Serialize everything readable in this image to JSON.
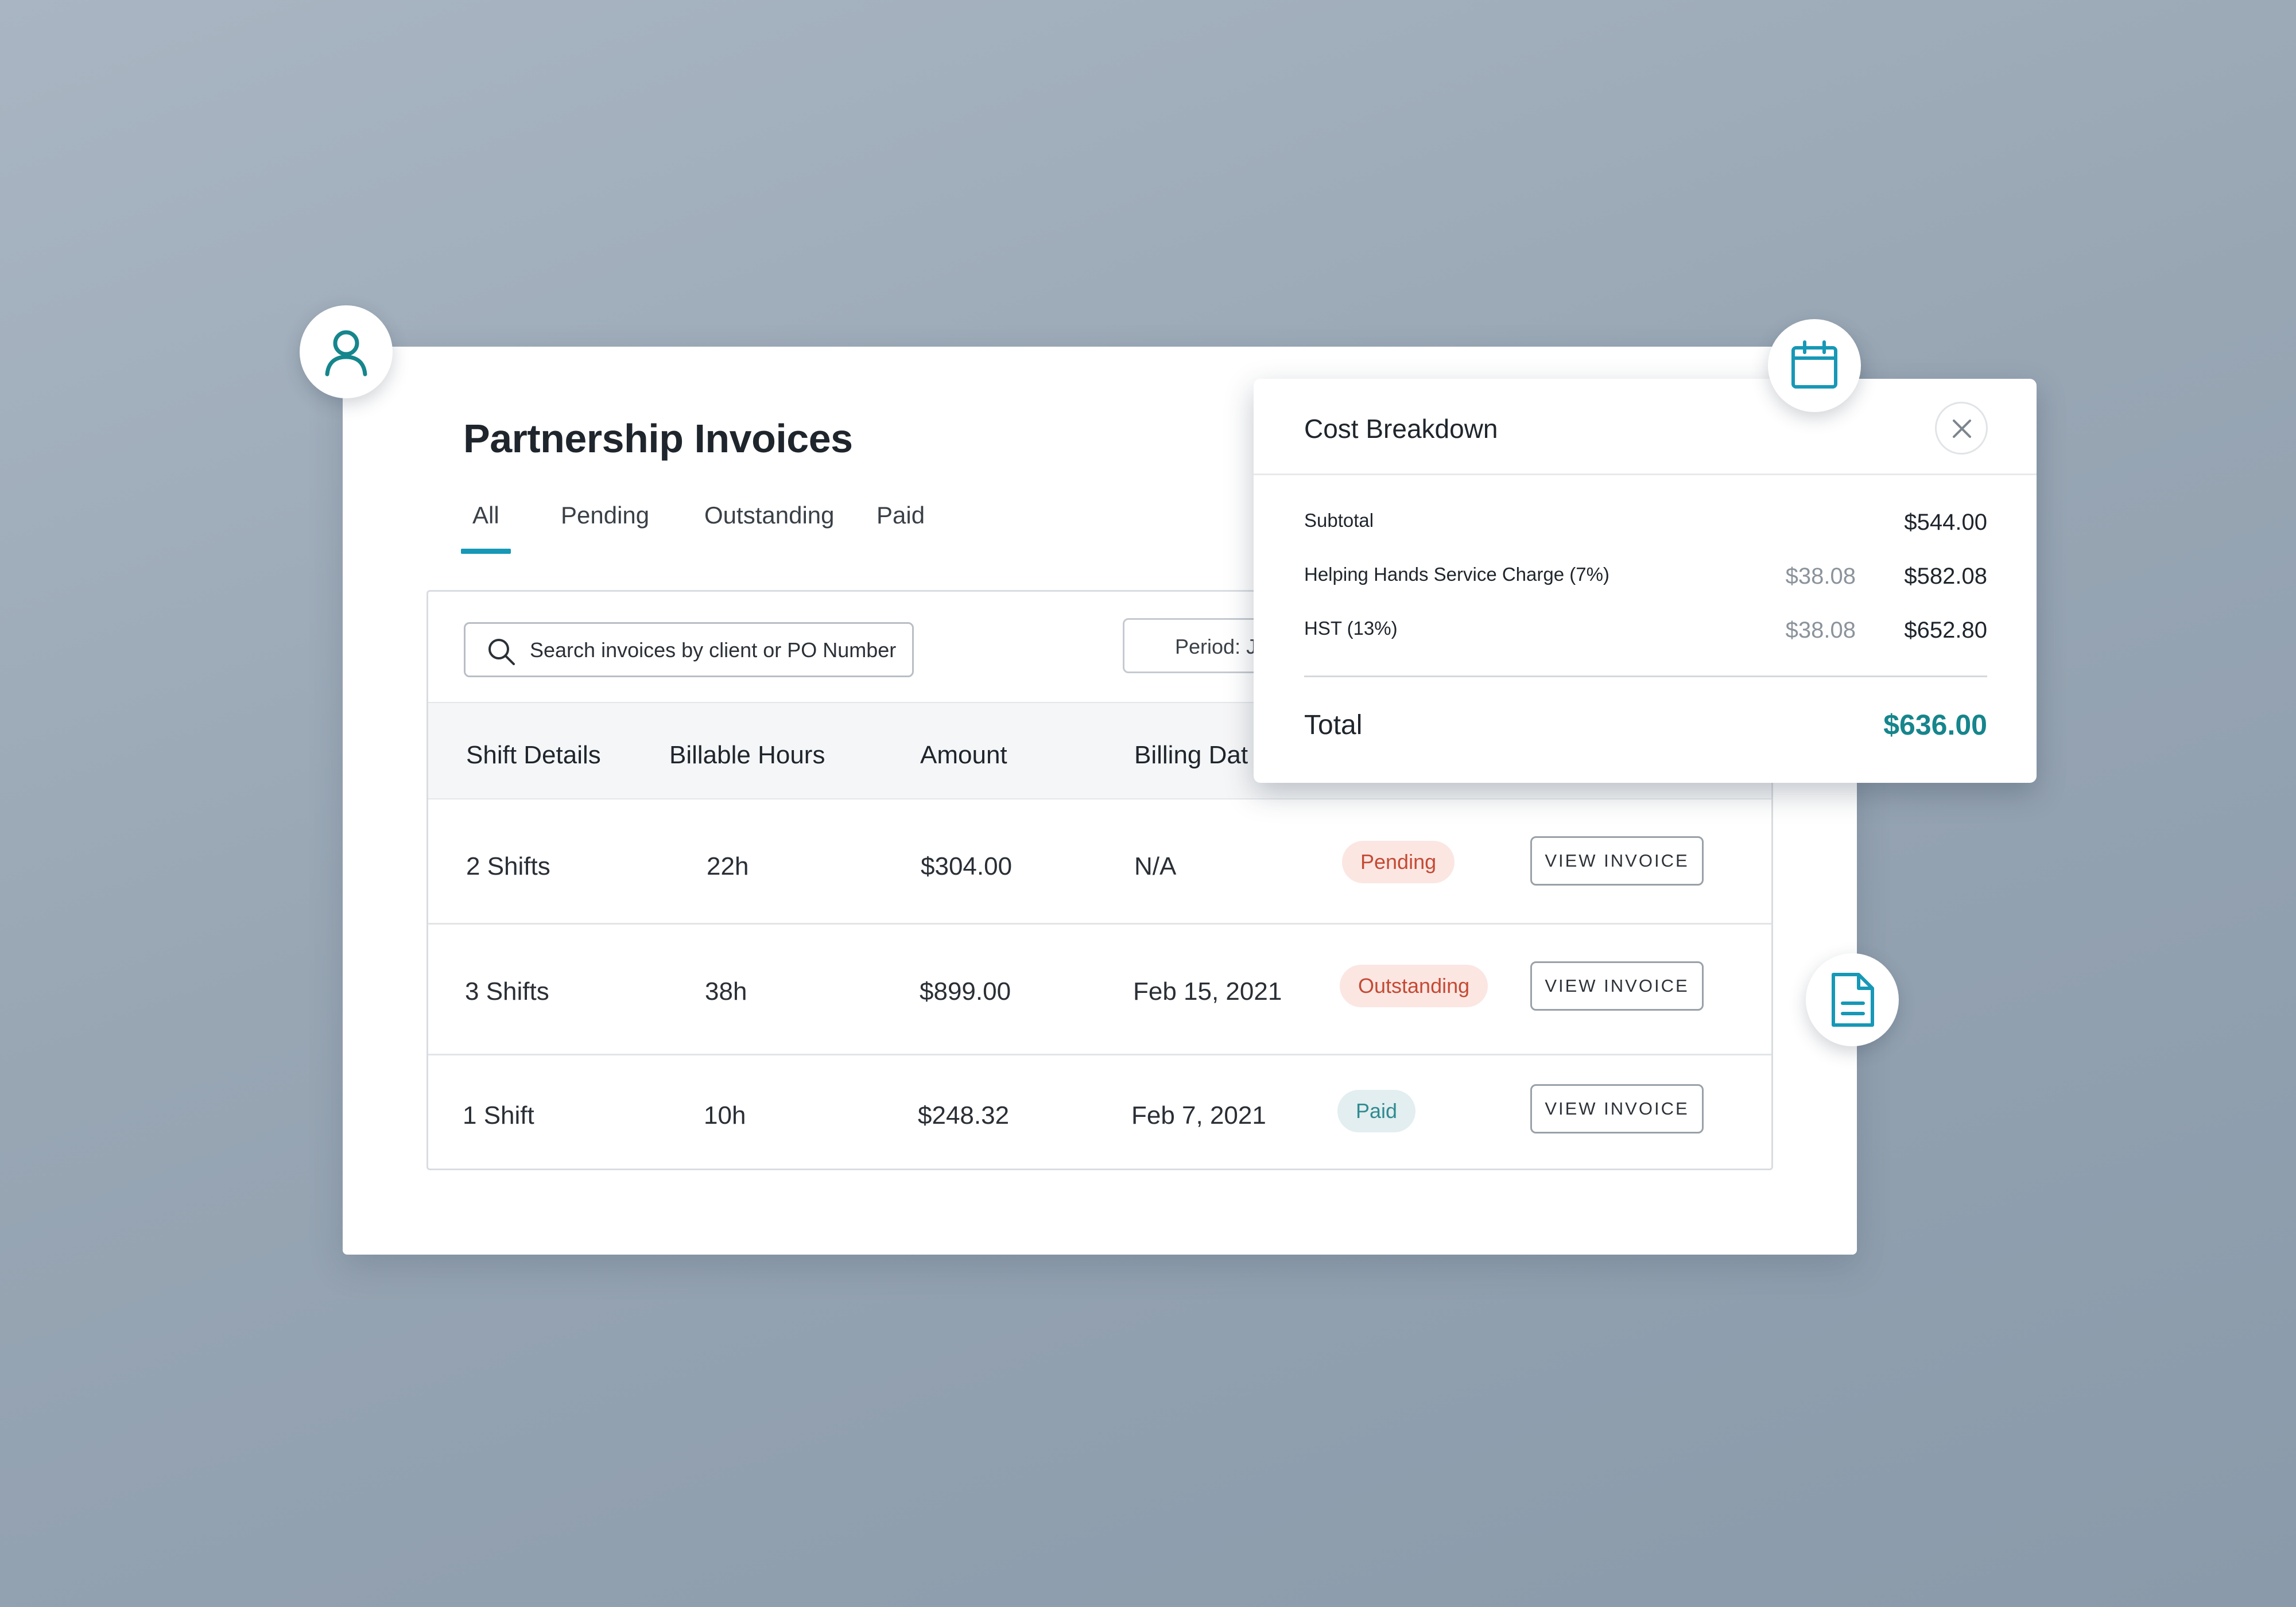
{
  "page": {
    "title": "Partnership Invoices",
    "tabs": [
      {
        "label": "All",
        "active": true
      },
      {
        "label": "Pending",
        "active": false
      },
      {
        "label": "Outstanding",
        "active": false
      },
      {
        "label": "Paid",
        "active": false
      }
    ]
  },
  "search": {
    "placeholder": "Search invoices by client or PO Number"
  },
  "period": {
    "label": "Period: J"
  },
  "table": {
    "columns": [
      "Shift Details",
      "Billable Hours",
      "Amount",
      "Billing Dat"
    ],
    "rows": [
      {
        "shifts": "2 Shifts",
        "hours": "22h",
        "amount": "$304.00",
        "date": "N/A",
        "status": "Pending",
        "action": "VIEW INVOICE"
      },
      {
        "shifts": "3 Shifts",
        "hours": "38h",
        "amount": "$899.00",
        "date": "Feb 15, 2021",
        "status": "Outstanding",
        "action": "VIEW INVOICE"
      },
      {
        "shifts": "1 Shift",
        "hours": "10h",
        "amount": "$248.32",
        "date": "Feb 7, 2021",
        "status": "Paid",
        "action": "VIEW INVOICE"
      }
    ]
  },
  "cost_breakdown": {
    "title": "Cost Breakdown",
    "lines": [
      {
        "label": "Subtotal",
        "amount": "",
        "running": "$544.00"
      },
      {
        "label": "Helping Hands Service Charge (7%)",
        "amount": "$38.08",
        "running": "$582.08"
      },
      {
        "label": "HST (13%)",
        "amount": "$38.08",
        "running": "$652.80"
      }
    ],
    "total_label": "Total",
    "total_value": "$636.00"
  },
  "icons": {
    "user": "user-icon",
    "calendar": "calendar-icon",
    "document": "document-icon",
    "search": "search-icon",
    "close": "close-icon"
  },
  "colors": {
    "accent": "#1798b6",
    "user_icon": "#15868c",
    "total": "#16858c",
    "pending": "#c44a34",
    "paid": "#2f8b92"
  }
}
